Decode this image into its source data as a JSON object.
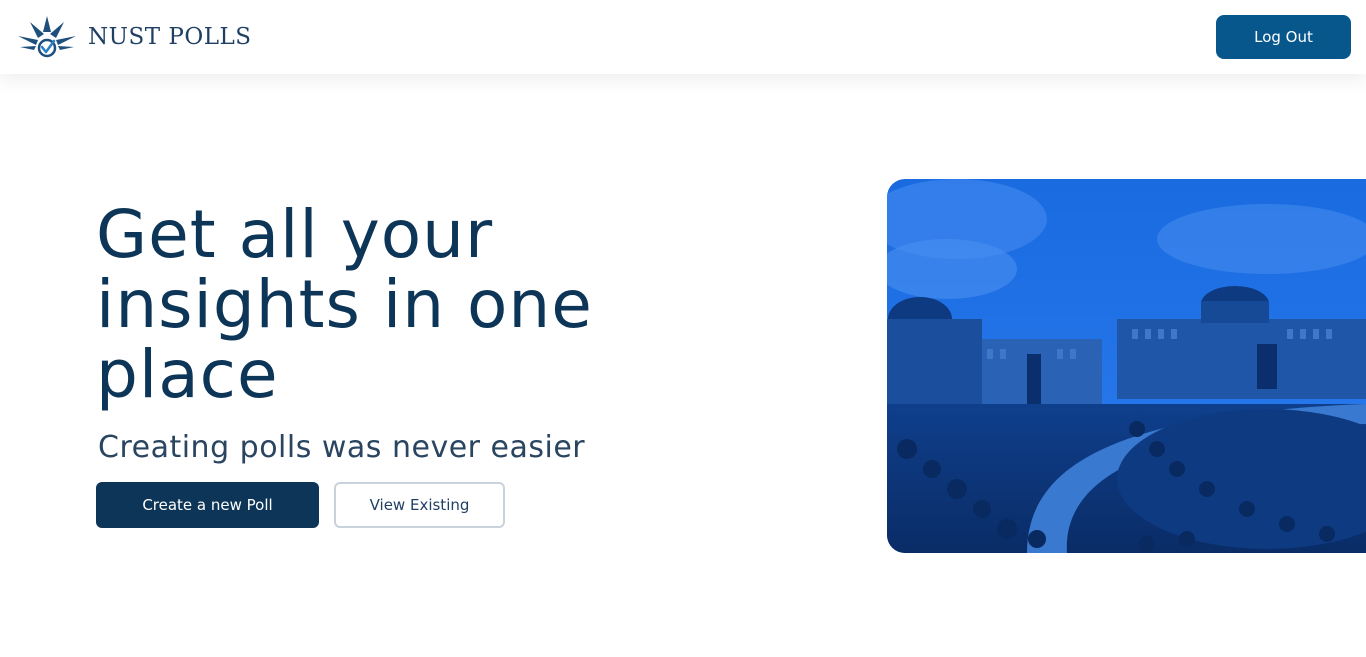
{
  "app": {
    "brand_name": "NUST POLLS",
    "logo_icon": "star-checkmark-logo",
    "brand_color": "#1f3f63"
  },
  "header": {
    "logout_label": "Log Out",
    "logout_color": "#08578c"
  },
  "hero": {
    "title": "Get all your insights in one place",
    "subtitle": "Creating polls was never easier",
    "primary_button_label": "Create a new Poll",
    "secondary_button_label": "View Existing",
    "title_color": "#0d3557"
  },
  "image": {
    "subject": "campus-buildings-photo",
    "tint": "#1565d8"
  }
}
